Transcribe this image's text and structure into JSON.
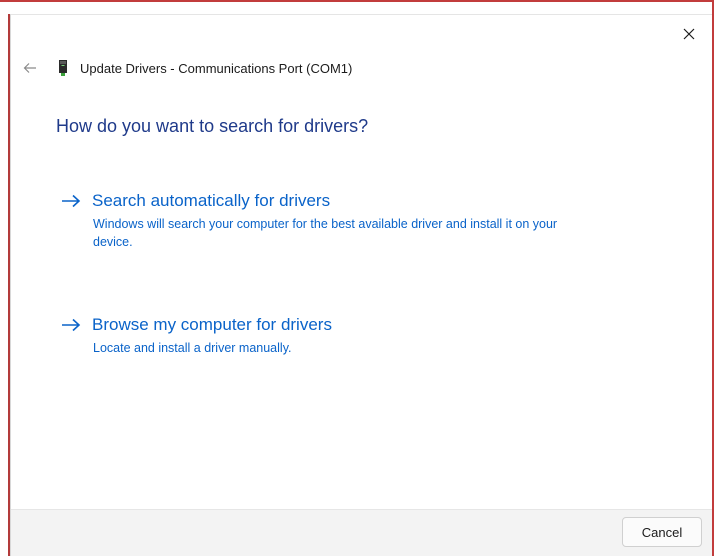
{
  "window": {
    "title": "Update Drivers - Communications Port (COM1)",
    "close_icon": "close-icon",
    "back_icon": "back-arrow-icon",
    "device_icon": "device-icon"
  },
  "heading": "How do you want to search for drivers?",
  "options": [
    {
      "title": "Search automatically for drivers",
      "description": "Windows will search your computer for the best available driver and install it on your device.",
      "icon": "arrow-right-icon"
    },
    {
      "title": "Browse my computer for drivers",
      "description": "Locate and install a driver manually.",
      "icon": "arrow-right-icon"
    }
  ],
  "footer": {
    "cancel_label": "Cancel"
  },
  "colors": {
    "heading": "#1f3a8a",
    "link": "#0a63c9",
    "footer_bg": "#f3f3f3"
  }
}
